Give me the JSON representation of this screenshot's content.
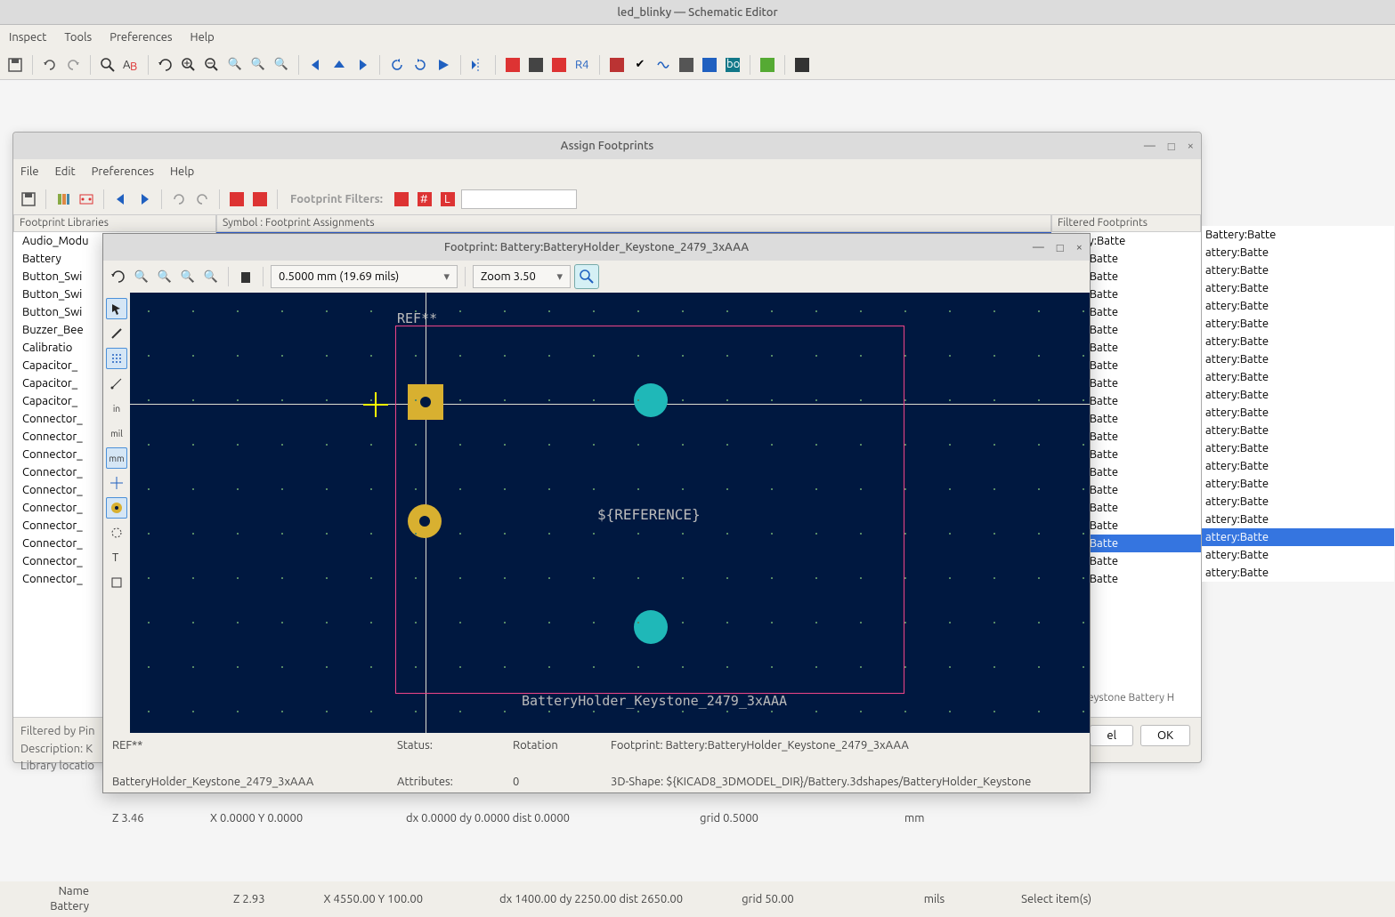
{
  "main": {
    "title": "led_blinky — Schematic Editor",
    "menu": [
      "Inspect",
      "Tools",
      "Preferences",
      "Help"
    ]
  },
  "assign": {
    "title": "Assign Footprints",
    "menu": [
      "File",
      "Edit",
      "Preferences",
      "Help"
    ],
    "filter_label": "Footprint Filters:",
    "cols": {
      "lib": "Footprint Libraries",
      "sym": "Symbol : Footprint Assignments",
      "filt": "Filtered Footprints"
    },
    "libs": [
      "Audio_Modu",
      "Battery",
      "Button_Swi",
      "Button_Swi",
      "Button_Swi",
      "Buzzer_Bee",
      "Calibratio",
      "Capacitor_",
      "Capacitor_",
      "Capacitor_",
      "Connector_",
      "Connector_",
      "Connector_",
      "Connector_",
      "Connector_",
      "Connector_",
      "Connector_",
      "Connector_",
      "Connector_",
      "Connector_"
    ],
    "filtered": [
      "Battery:Batte",
      "attery:Batte",
      "attery:Batte",
      "attery:Batte",
      "attery:Batte",
      "attery:Batte",
      "attery:Batte",
      "attery:Batte",
      "attery:Batte",
      "attery:Batte",
      "attery:Batte",
      "attery:Batte",
      "attery:Batte",
      "attery:Batte",
      "attery:Batte",
      "attery:Batte",
      "attery:Batte",
      "attery:Batte",
      "attery:Batte",
      "attery:Batte"
    ],
    "filtered_selected_index": 17,
    "bottom": {
      "l1": "Filtered by Pin",
      "l2": "Description: K",
      "l3": "Library locatio",
      "r2": "eystone Battery H"
    },
    "buttons": {
      "cancel": "el",
      "ok": "OK"
    }
  },
  "fp": {
    "title": "Footprint: Battery:BatteryHolder_Keystone_2479_3xAAA",
    "grid_dd": "0.5000 mm (19.69 mils)",
    "zoom_dd": "Zoom 3.50",
    "left_labels": {
      "in": "in",
      "mil": "mil",
      "mm": "mm"
    },
    "ref": "REF**",
    "ref2": "${REFERENCE}",
    "val": "BatteryHolder_Keystone_2479_3xAAA",
    "status": {
      "ref": "REF**",
      "val": "BatteryHolder_Keystone_2479_3xAAA",
      "status_lbl": "Status:",
      "attrs_lbl": "Attributes:",
      "rot_lbl": "Rotation",
      "rot": "0",
      "fp_line": "Footprint: Battery:BatteryHolder_Keystone_2479_3xAAA",
      "shape_line": "3D-Shape: ${KICAD8_3DMODEL_DIR}/Battery.3dshapes/BatteryHolder_Keystone",
      "z": "Z 3.46",
      "xy": "X 0.0000  Y 0.0000",
      "dxy": "dx 0.0000  dy 0.0000  dist 0.0000",
      "grid": "grid 0.5000",
      "unit": "mm"
    }
  },
  "bottom": {
    "name_lbl": "Name",
    "name_val": "Battery",
    "z": "Z 2.93",
    "xy": "X 4550.00  Y  100.00",
    "dxy": "dx 1400.00  dy  2250.00  dist 2650.00",
    "grid": "grid 50.00",
    "unit": "mils",
    "sel": "Select item(s)"
  }
}
